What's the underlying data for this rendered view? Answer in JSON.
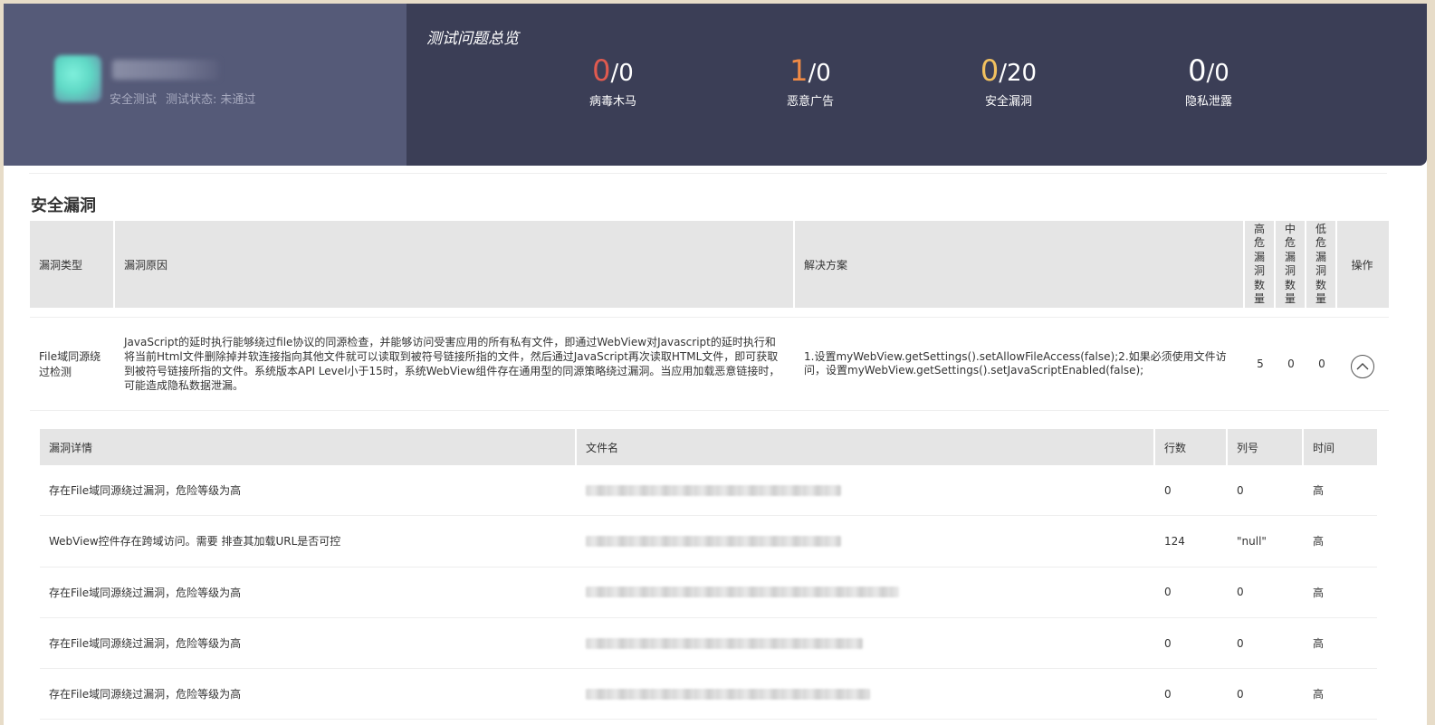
{
  "header": {
    "app_meta": {
      "test_type": "安全测试",
      "status_label": "测试状态:",
      "status_value": "未通过"
    },
    "overview_title": "测试问题总览",
    "stats": [
      {
        "found": "0",
        "total": "0",
        "label": "病毒木马",
        "color": "#e05a4f"
      },
      {
        "found": "1",
        "total": "0",
        "label": "恶意广告",
        "color": "#f08a45"
      },
      {
        "found": "0",
        "total": "20",
        "label": "安全漏洞",
        "color": "#f2c15f"
      },
      {
        "found": "0",
        "total": "0",
        "label": "隐私泄露",
        "color": "#ffffff"
      }
    ]
  },
  "section": {
    "title": "安全漏洞",
    "columns": {
      "type": "漏洞类型",
      "reason": "漏洞原因",
      "solution": "解决方案",
      "high": "高危漏洞数量",
      "mid": "中危漏洞数量",
      "low": "低危漏洞数量",
      "op": "操作"
    },
    "row": {
      "type": "File域同源绕过检测",
      "reason": "JavaScript的延时执行能够绕过file协议的同源检查，并能够访问受害应用的所有私有文件，即通过WebView对Javascript的延时执行和将当前Html文件删除掉并软连接指向其他文件就可以读取到被符号链接所指的文件，然后通过JavaScript再次读取HTML文件，即可获取到被符号链接所指的文件。系统版本API Level小于15时，系统WebView组件存在通用型的同源策略绕过漏洞。当应用加载恶意链接时，可能造成隐私数据泄漏。",
      "solution": "1.设置myWebView.getSettings().setAllowFileAccess(false);2.如果必须使用文件访问，设置myWebView.getSettings().setJavaScriptEnabled(false);",
      "high": "5",
      "mid": "0",
      "low": "0"
    }
  },
  "details": {
    "columns": {
      "detail": "漏洞详情",
      "file": "文件名",
      "line": "行数",
      "col": "列号",
      "time": "时间"
    },
    "rows": [
      {
        "detail": "存在File域同源绕过漏洞，危险等级为高",
        "line": "0",
        "col": "0",
        "time": "高"
      },
      {
        "detail": "WebView控件存在跨域访问。需要 排查其加载URL是否可控",
        "line": "124",
        "col": "\"null\"",
        "time": "高"
      },
      {
        "detail": "存在File域同源绕过漏洞，危险等级为高",
        "line": "0",
        "col": "0",
        "time": "高"
      },
      {
        "detail": "存在File域同源绕过漏洞，危险等级为高",
        "line": "0",
        "col": "0",
        "time": "高"
      },
      {
        "detail": "存在File域同源绕过漏洞，危险等级为高",
        "line": "0",
        "col": "0",
        "time": "高"
      }
    ]
  }
}
